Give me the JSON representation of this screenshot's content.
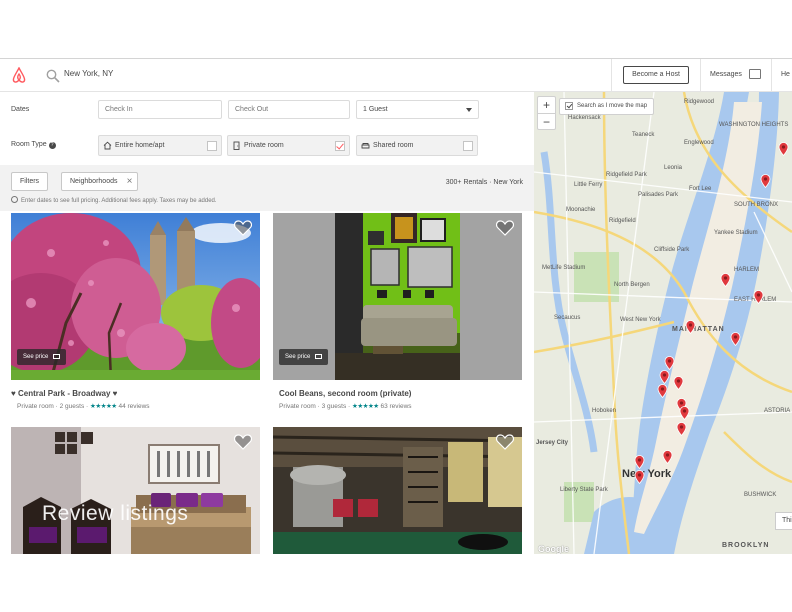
{
  "header": {
    "search_value": "New York, NY",
    "become_host_label": "Become a Host",
    "messages_label": "Messages",
    "help_label": "He"
  },
  "filters": {
    "dates_label": "Dates",
    "check_in_placeholder": "Check In",
    "check_out_placeholder": "Check Out",
    "guests_value": "1 Guest",
    "room_type_label": "Room Type",
    "room_types": [
      {
        "label": "Entire home/apt",
        "checked": false,
        "icon": "home-icon"
      },
      {
        "label": "Private room",
        "checked": true,
        "icon": "door-icon"
      },
      {
        "label": "Shared room",
        "checked": false,
        "icon": "sofa-icon"
      }
    ],
    "filters_button": "Filters",
    "neighborhoods_chip": "Neighborhoods",
    "rentals_count": "300+ Rentals · New York",
    "info_text": "Enter dates to see full pricing. Additional fees apply. Taxes may be added."
  },
  "listings": [
    {
      "title": "♥ Central Park - Broadway ♥",
      "type": "Private room",
      "guests": "2 guests",
      "stars": "★★★★★",
      "reviews": "44 reviews",
      "see_price": "See price"
    },
    {
      "title": "Cool Beans, second room (private)",
      "type": "Private room",
      "guests": "3 guests",
      "stars": "★★★★★",
      "reviews": "63 reviews",
      "see_price": "See price"
    },
    {
      "title": "",
      "type": "",
      "guests": "",
      "stars": "",
      "reviews": "",
      "overlay_text": "Review listings"
    },
    {
      "title": "",
      "type": "",
      "guests": "",
      "stars": "",
      "reviews": ""
    }
  ],
  "map": {
    "zoom_in": "+",
    "zoom_out": "−",
    "search_as_move": "Search as I move the map",
    "google_label": "Google",
    "this_label": "Thi",
    "labels": [
      "Hackensack",
      "Ridgewood",
      "Teaneck",
      "Englewood",
      "Leonia",
      "Little Ferry",
      "Ridgefield Park",
      "Palisades Park",
      "Fort Lee",
      "Moonachie",
      "Ridgefield",
      "Yankee Stadium",
      "Cliffside Park",
      "MetLife Stadium",
      "North Bergen",
      "HARLEM",
      "EAST HARLEM",
      "Secaucus",
      "West New York",
      "MANHATTAN",
      "Hoboken",
      "Jersey City",
      "New York",
      "Liberty State Park",
      "BROOKLYN",
      "WASHINGTON HEIGHTS",
      "SOUTH BRONX",
      "ASTORIA",
      "BUSHWICK"
    ]
  },
  "colors": {
    "brand": "#FF5A5F",
    "teal": "#008489",
    "water": "#a8c8ee"
  }
}
